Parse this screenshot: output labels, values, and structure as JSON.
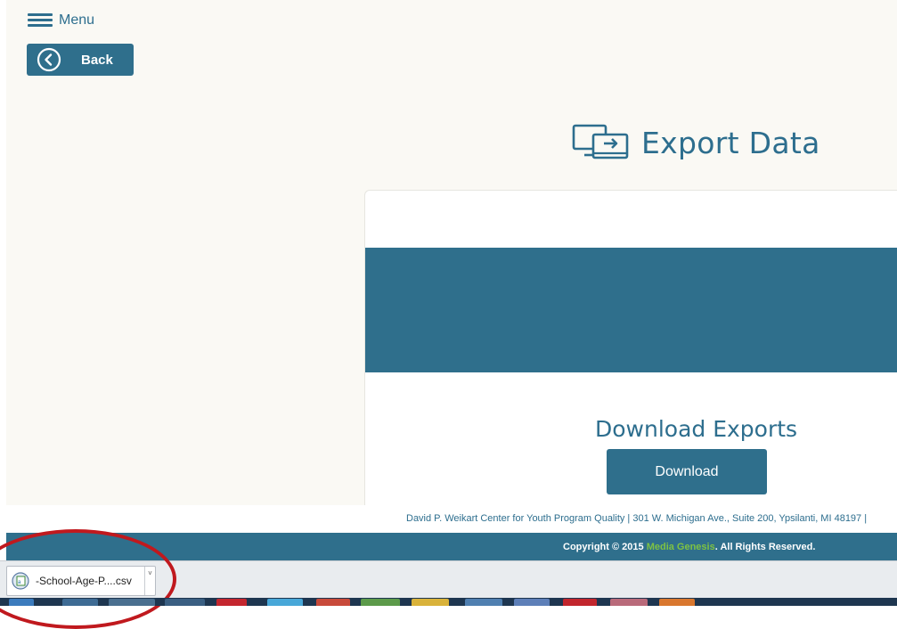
{
  "nav": {
    "menu_label": "Menu",
    "back_label": "Back"
  },
  "page": {
    "title": "Export Data",
    "title_icon": "devices-export-icon"
  },
  "download_section": {
    "heading": "Download Exports",
    "button_label": "Download"
  },
  "footer": {
    "address": "David P. Weikart Center for Youth Program Quality  |  301 W. Michigan Ave., Suite 200, Ypsilanti, MI 48197  |",
    "copyright_prefix": "Copyright © 2015 ",
    "copyright_brand": "Media Genesis",
    "copyright_suffix": ". All Rights Reserved."
  },
  "download_bar": {
    "file_name": "-School-Age-P....csv",
    "file_icon": "csv-file-icon",
    "menu_arrow": "˅"
  },
  "colors": {
    "brand_blue": "#2f6f8c",
    "brand_green": "#7ec242",
    "callout_red": "#c0191e",
    "page_bg": "#faf9f4"
  }
}
